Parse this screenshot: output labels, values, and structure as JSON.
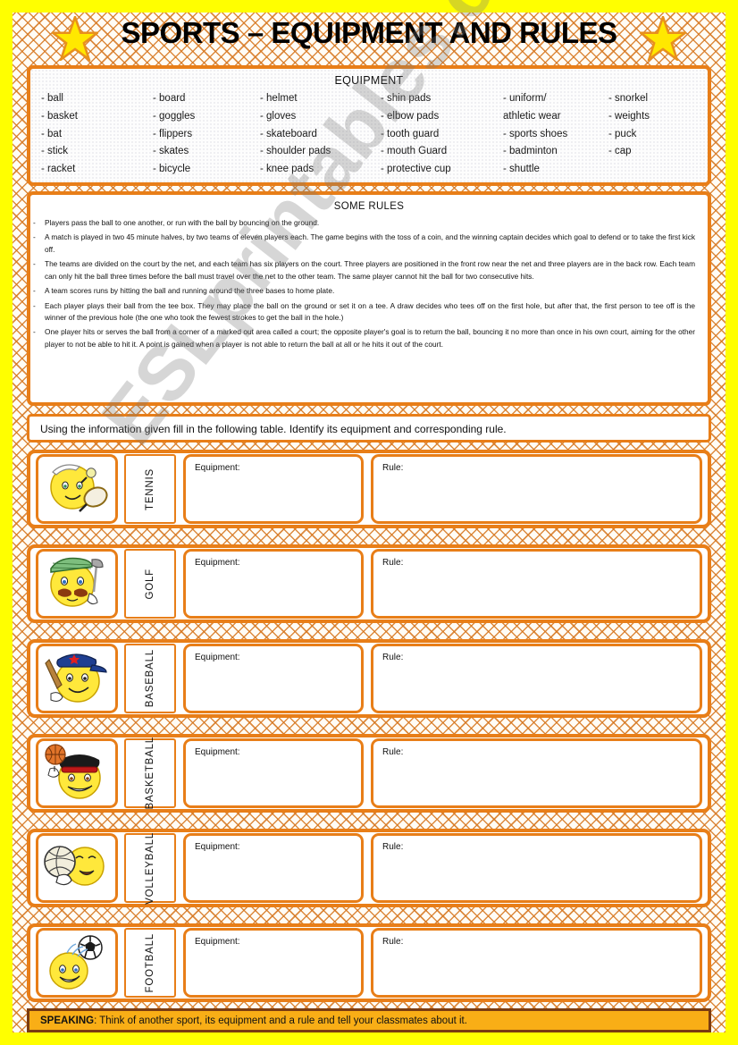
{
  "title": "SPORTS – EQUIPMENT AND RULES",
  "watermark": "ESLprintables.com",
  "equipment": {
    "heading": "EQUIPMENT",
    "columns": [
      [
        "- ball",
        "- basket",
        "- bat",
        "- stick",
        "- racket"
      ],
      [
        "- board",
        "- goggles",
        "- flippers",
        "- skates",
        "- bicycle"
      ],
      [
        "- helmet",
        "- gloves",
        "- skateboard",
        "- shoulder pads",
        "- knee pads"
      ],
      [
        "- shin pads",
        "- elbow pads",
        "- tooth guard",
        "- mouth Guard",
        "- protective cup"
      ],
      [
        "- uniform/",
        "athletic wear",
        "- sports shoes",
        "- badminton",
        "- shuttle"
      ],
      [
        "- snorkel",
        "- weights",
        "- puck",
        "- cap"
      ]
    ]
  },
  "rules": {
    "heading": "SOME RULES",
    "items": [
      "Players pass the ball to one another, or run with the ball by bouncing on the ground.",
      "A match is played in two 45 minute halves, by two teams of eleven players each. The game begins with the toss of a coin, and the winning captain decides which goal to defend or to take the first kick off.",
      "The teams are divided on the court by the net, and each team has six players on the court. Three players are positioned in the front row near the net and three players are in the back row. Each team can only hit the ball three times before the ball must travel over the net to the other team. The same player cannot hit the ball for two consecutive hits.",
      "A team scores runs by hitting the ball and running around the three bases to home plate.",
      "Each player plays their ball from the tee box. They may place the ball on the ground or set it on a tee. A draw decides who tees off on the first hole, but after that, the first person to tee off is the winner of the previous hole (the one who took the fewest strokes to get the ball in the hole.)",
      "One player hits or serves the ball from a corner of a marked out area called a court; the opposite player's goal is to return the ball, bouncing it no more than once in his own court, aiming for the other player to not be able to hit it. A point is gained when a player is not able to return the ball at all or he hits it out of the court."
    ]
  },
  "instruction": "Using the information given fill in the following table. Identify its equipment and corresponding rule.",
  "table": {
    "equipment_label": "Equipment:",
    "rule_label": "Rule:",
    "rows": [
      {
        "sport": "TENNIS",
        "icon": "tennis-smiley-icon",
        "equipment_value": "",
        "rule_value": ""
      },
      {
        "sport": "GOLF",
        "icon": "golf-smiley-icon",
        "equipment_value": "",
        "rule_value": ""
      },
      {
        "sport": "BASEBALL",
        "icon": "baseball-smiley-icon",
        "equipment_value": "",
        "rule_value": ""
      },
      {
        "sport": "BASKETBALL",
        "icon": "basketball-smiley-icon",
        "equipment_value": "",
        "rule_value": ""
      },
      {
        "sport": "VOLLEYBALL",
        "icon": "volleyball-smiley-icon",
        "equipment_value": "",
        "rule_value": ""
      },
      {
        "sport": "FOOTBALL",
        "icon": "football-smiley-icon",
        "equipment_value": "",
        "rule_value": ""
      }
    ]
  },
  "speaking": {
    "label": "SPEAKING",
    "separator": ": ",
    "text": "Think of another sport, its equipment and a rule and tell your classmates about it."
  },
  "colors": {
    "page_background": "#FFFF00",
    "frame_orange": "#E87E18",
    "star_yellow": "#FFE800",
    "speaking_bar": "#F9AE16",
    "speaking_border": "#7A3B10"
  }
}
